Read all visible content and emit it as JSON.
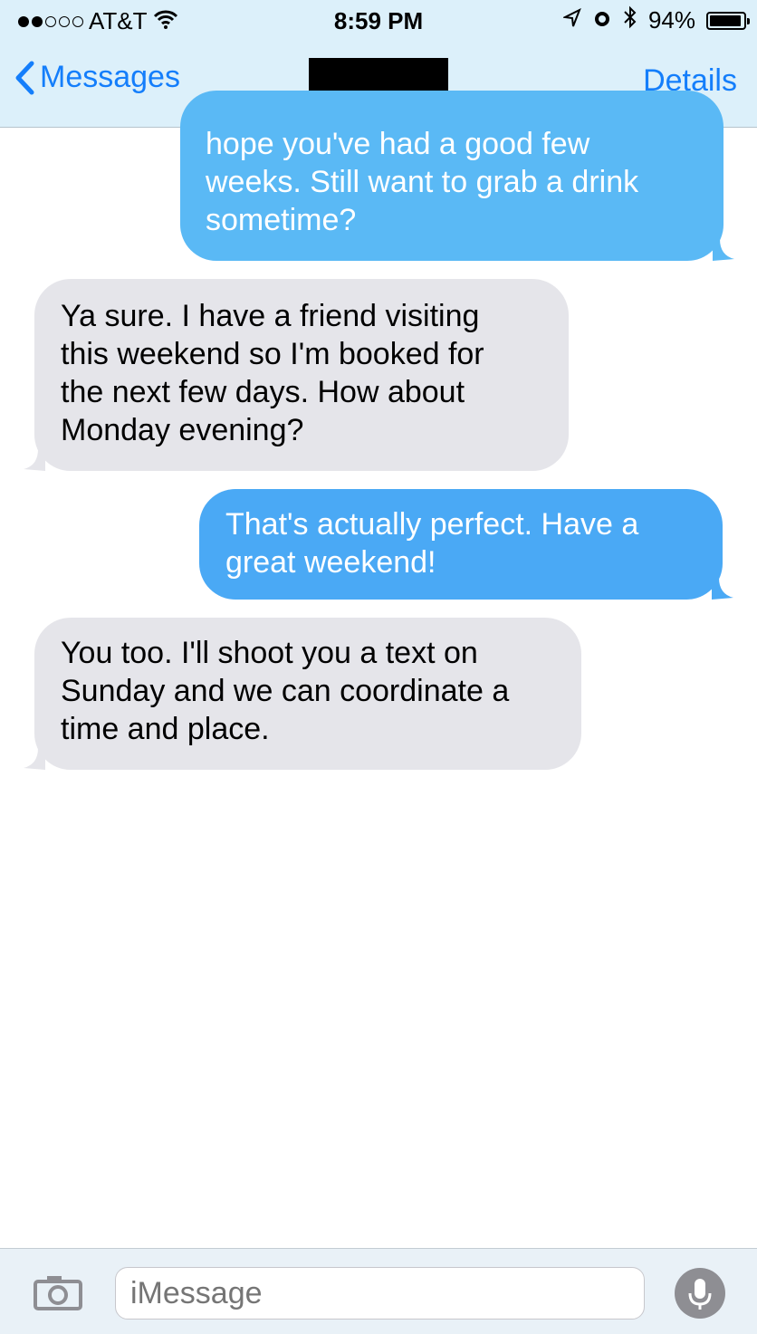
{
  "status_bar": {
    "carrier": "AT&T",
    "time": "8:59 PM",
    "battery": "94%",
    "signal_bars": 2,
    "signal_total": 5,
    "battery_level": 0.94,
    "icons": [
      "wifi-icon",
      "location-icon",
      "alarm-icon",
      "bluetooth-icon",
      "battery-icon"
    ]
  },
  "nav": {
    "back_label": "Messages",
    "details_label": "Details"
  },
  "messages": [
    {
      "direction": "sent",
      "text": "hope you've had a good few\nweeks. Still want to grab a drink\nsometime?"
    },
    {
      "direction": "received",
      "text": "Ya sure. I have a friend visiting\nthis weekend so I'm booked for\nthe next few days. How about\nMonday evening?"
    },
    {
      "direction": "sent",
      "text": "That's actually perfect. Have a\ngreat weekend!"
    },
    {
      "direction": "received",
      "text": "You too. I'll shoot you a text on\nSunday and we can coordinate a\ntime and place."
    }
  ],
  "compose": {
    "placeholder": "iMessage"
  },
  "colors": {
    "accent": "#147efb",
    "sent_bubble": "#4aa9f5",
    "received_bubble": "#e5e5ea"
  }
}
